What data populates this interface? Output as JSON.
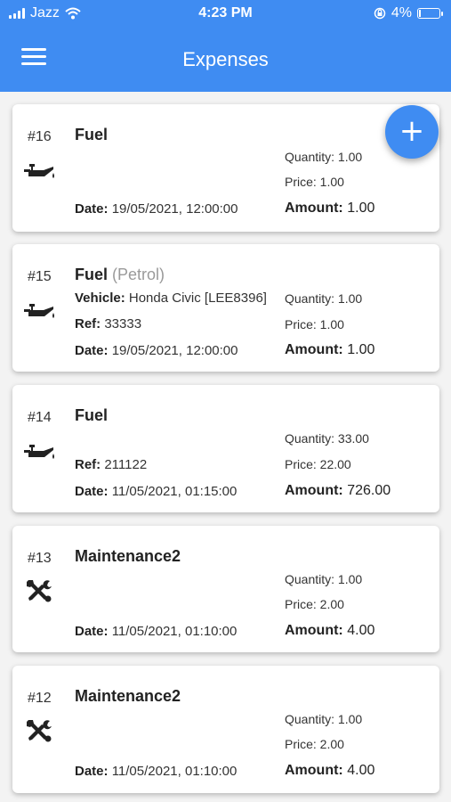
{
  "status_bar": {
    "carrier": "Jazz",
    "time": "4:23 PM",
    "battery": "4%"
  },
  "app_bar": {
    "title": "Expenses"
  },
  "expenses": [
    {
      "number": "#16",
      "type": "Fuel",
      "subtype": "",
      "icon": "oil-can-icon",
      "vehicle_label": "",
      "vehicle": "",
      "ref_label": "",
      "ref": "",
      "date_label": "Date:",
      "date": "19/05/2021, 12:00:00",
      "quantity": "Quantity: 1.00",
      "price": "Price: 1.00",
      "amount_label": "Amount:",
      "amount": "1.00"
    },
    {
      "number": "#15",
      "type": "Fuel",
      "subtype": "(Petrol)",
      "icon": "oil-can-icon",
      "vehicle_label": "Vehicle:",
      "vehicle": "Honda Civic [LEE8396]",
      "ref_label": "Ref:",
      "ref": "33333",
      "date_label": "Date:",
      "date": "19/05/2021, 12:00:00",
      "quantity": "Quantity: 1.00",
      "price": "Price: 1.00",
      "amount_label": "Amount:",
      "amount": "1.00"
    },
    {
      "number": "#14",
      "type": "Fuel",
      "subtype": "",
      "icon": "oil-can-icon",
      "vehicle_label": "",
      "vehicle": "",
      "ref_label": "Ref:",
      "ref": "211122",
      "date_label": "Date:",
      "date": "11/05/2021, 01:15:00",
      "quantity": "Quantity: 33.00",
      "price": "Price: 22.00",
      "amount_label": "Amount:",
      "amount": "726.00"
    },
    {
      "number": "#13",
      "type": "Maintenance2",
      "subtype": "",
      "icon": "tools-icon",
      "vehicle_label": "",
      "vehicle": "",
      "ref_label": "",
      "ref": "",
      "date_label": "Date:",
      "date": "11/05/2021, 01:10:00",
      "quantity": "Quantity: 1.00",
      "price": "Price: 2.00",
      "amount_label": "Amount:",
      "amount": "4.00"
    },
    {
      "number": "#12",
      "type": "Maintenance2",
      "subtype": "",
      "icon": "tools-icon",
      "vehicle_label": "",
      "vehicle": "",
      "ref_label": "",
      "ref": "",
      "date_label": "Date:",
      "date": "11/05/2021, 01:10:00",
      "quantity": "Quantity: 1.00",
      "price": "Price: 2.00",
      "amount_label": "Amount:",
      "amount": "4.00"
    }
  ],
  "fab": {
    "label": "+"
  },
  "colors": {
    "primary": "#3f8cf2",
    "card_bg": "#ffffff",
    "page_bg": "#f3f3f3",
    "subtype_text": "#9a9a9a"
  }
}
